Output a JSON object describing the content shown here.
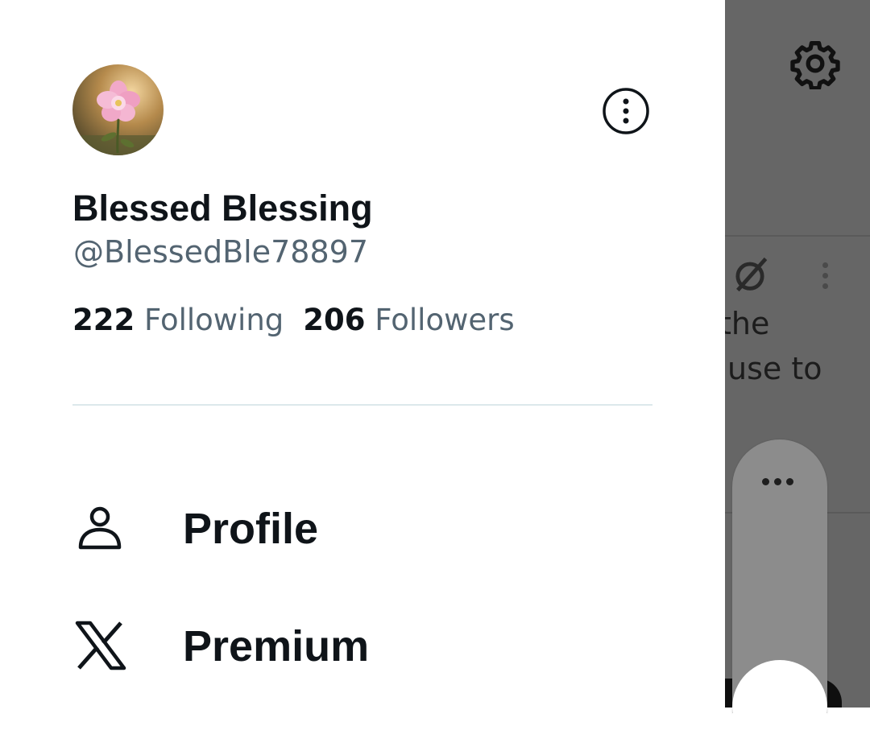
{
  "profile": {
    "display_name": "Blessed Blessing",
    "handle": "@BlessedBle78897",
    "following_count": "222",
    "following_label": "Following",
    "followers_count": "206",
    "followers_label": "Followers"
  },
  "menu": [
    {
      "label": "Profile",
      "icon": "person-icon"
    },
    {
      "label": "Premium",
      "icon": "x-logo-icon"
    }
  ],
  "background": {
    "text_line_1": "the",
    "text_line_2": "use to"
  },
  "colors": {
    "primary_text": "#0f1419",
    "secondary_text": "#536471",
    "divider": "#dce8eb",
    "overlay": "#666666"
  }
}
